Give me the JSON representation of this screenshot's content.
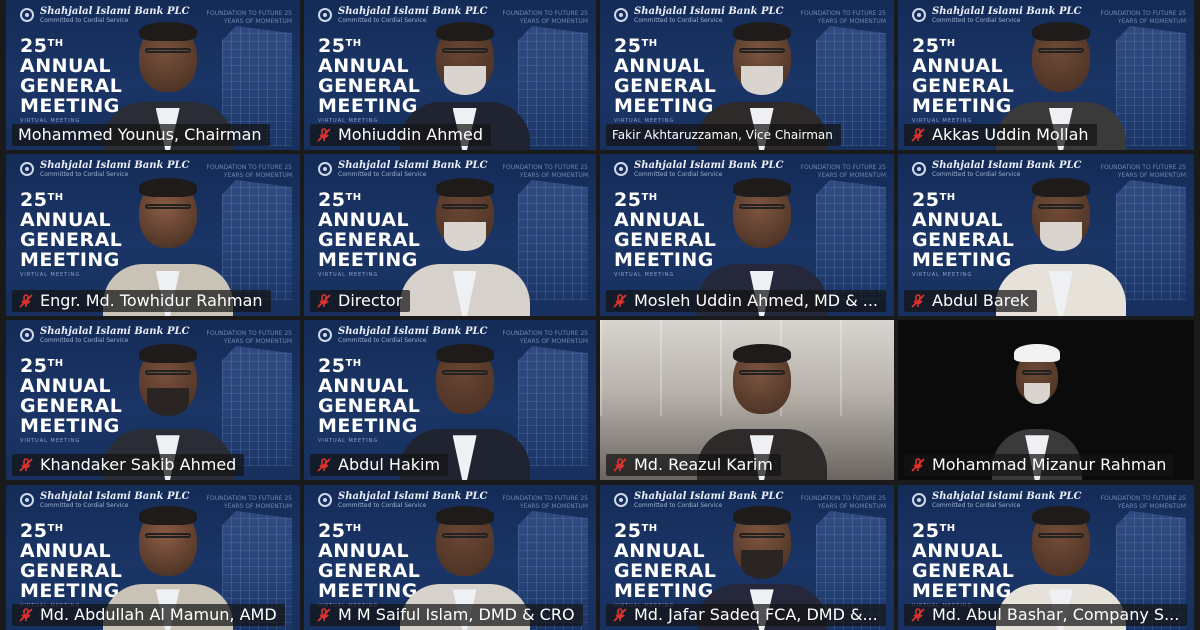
{
  "meeting": {
    "bank_name": "Shahjalal Islami Bank PLC",
    "bank_sub": "Committed to Cordial Service",
    "tagline": "FOUNDATION TO FUTURE 25 YEARS OF MOMENTUM",
    "slide_title_num": "25",
    "slide_title_sup": "TH",
    "slide_title_l2": "ANNUAL",
    "slide_title_l3": "GENERAL",
    "slide_title_l4": "MEETING",
    "virtual_text": "VIRTUAL MEETING"
  },
  "participants": [
    {
      "name": "Mohammed Younus, Chairman",
      "muted": false,
      "bg": "agm"
    },
    {
      "name": "Mohiuddin Ahmed",
      "muted": true,
      "bg": "agm"
    },
    {
      "name": "Fakir Akhtaruzzaman, Vice Chairman",
      "muted": false,
      "bg": "agm",
      "small": true
    },
    {
      "name": "Akkas Uddin Mollah",
      "muted": true,
      "bg": "agm"
    },
    {
      "name": "Engr. Md. Towhidur Rahman",
      "muted": true,
      "bg": "agm"
    },
    {
      "name": "Director",
      "muted": true,
      "bg": "agm"
    },
    {
      "name": "Mosleh Uddin Ahmed, MD & ...",
      "muted": true,
      "bg": "agm"
    },
    {
      "name": "Abdul Barek",
      "muted": true,
      "bg": "agm"
    },
    {
      "name": "Khandaker Sakib Ahmed",
      "muted": true,
      "bg": "agm"
    },
    {
      "name": "Abdul Hakim",
      "muted": true,
      "bg": "agm"
    },
    {
      "name": "Md. Reazul Karim",
      "muted": true,
      "bg": "room"
    },
    {
      "name": "Mohammad Mizanur Rahman",
      "muted": true,
      "bg": "dark"
    },
    {
      "name": "Md. Abdullah Al Mamun, AMD",
      "muted": true,
      "bg": "agm"
    },
    {
      "name": "M M Saiful Islam, DMD & CRO",
      "muted": true,
      "bg": "agm"
    },
    {
      "name": "Md. Jafar Sadeq FCA, DMD &...",
      "muted": true,
      "bg": "agm"
    },
    {
      "name": "Md. Abul Bashar, Company S...",
      "muted": true,
      "bg": "agm"
    }
  ],
  "colors": {
    "slide_bg": "#1a3566",
    "mute_red": "#e0322e"
  }
}
